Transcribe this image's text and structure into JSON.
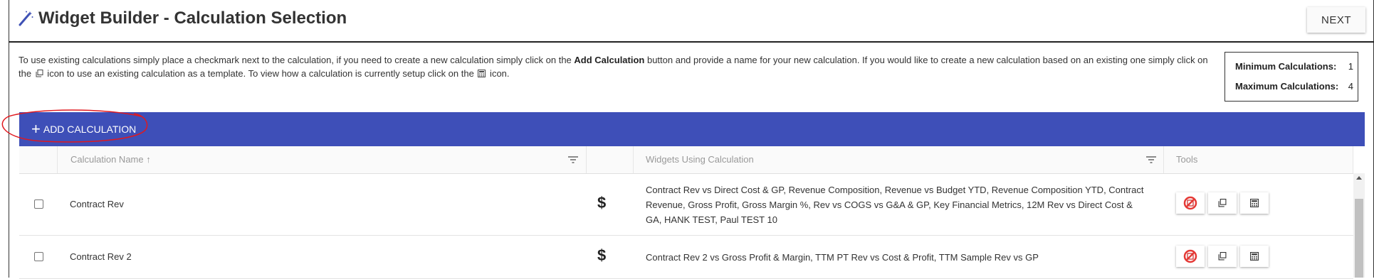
{
  "header": {
    "title": "Widget Builder - Calculation Selection",
    "next_label": "NEXT"
  },
  "instructions": {
    "part1": "To use existing calculations simply place a checkmark next to the calculation, if you need to create a new calculation simply click on the ",
    "bold": "Add Calculation",
    "part2": " button and provide a name for your new calculation. If you would like to create a new calculation based on an existing one simply click on the ",
    "part3": " icon to use an existing calculation as a template. To view how a calculation is currently setup click on the ",
    "part4": " icon."
  },
  "limits": {
    "min_label": "Minimum Calculations:",
    "min_value": "1",
    "max_label": "Maximum Calculations:",
    "max_value": "4"
  },
  "toolbar": {
    "add_label": "ADD CALCULATION"
  },
  "grid": {
    "columns": {
      "name": "Calculation Name",
      "sort_indicator": "↑",
      "widgets": "Widgets Using Calculation",
      "tools": "Tools"
    },
    "rows": [
      {
        "name": "Contract Rev",
        "symbol": "$",
        "widgets": "Contract Rev vs Direct Cost & GP, Revenue Composition, Revenue vs Budget YTD, Revenue Composition YTD, Contract Revenue, Gross Profit, Gross Margin %, Rev vs COGS vs G&A & GP, Key Financial Metrics, 12M Rev vs Direct Cost & GA, HANK TEST, Paul TEST 10"
      },
      {
        "name": "Contract Rev 2",
        "symbol": "$",
        "widgets": "Contract Rev 2 vs Gross Profit & Margin, TTM PT Rev vs Cost & Profit, TTM Sample Rev vs GP"
      }
    ]
  },
  "colors": {
    "accent": "#3e4fb8",
    "annotation": "#e0191f",
    "delete_icon": "#e53935"
  },
  "icons": [
    "magic-wand-icon",
    "plus-icon",
    "filter-icon",
    "copy-icon",
    "calculator-icon",
    "no-delete-icon"
  ]
}
